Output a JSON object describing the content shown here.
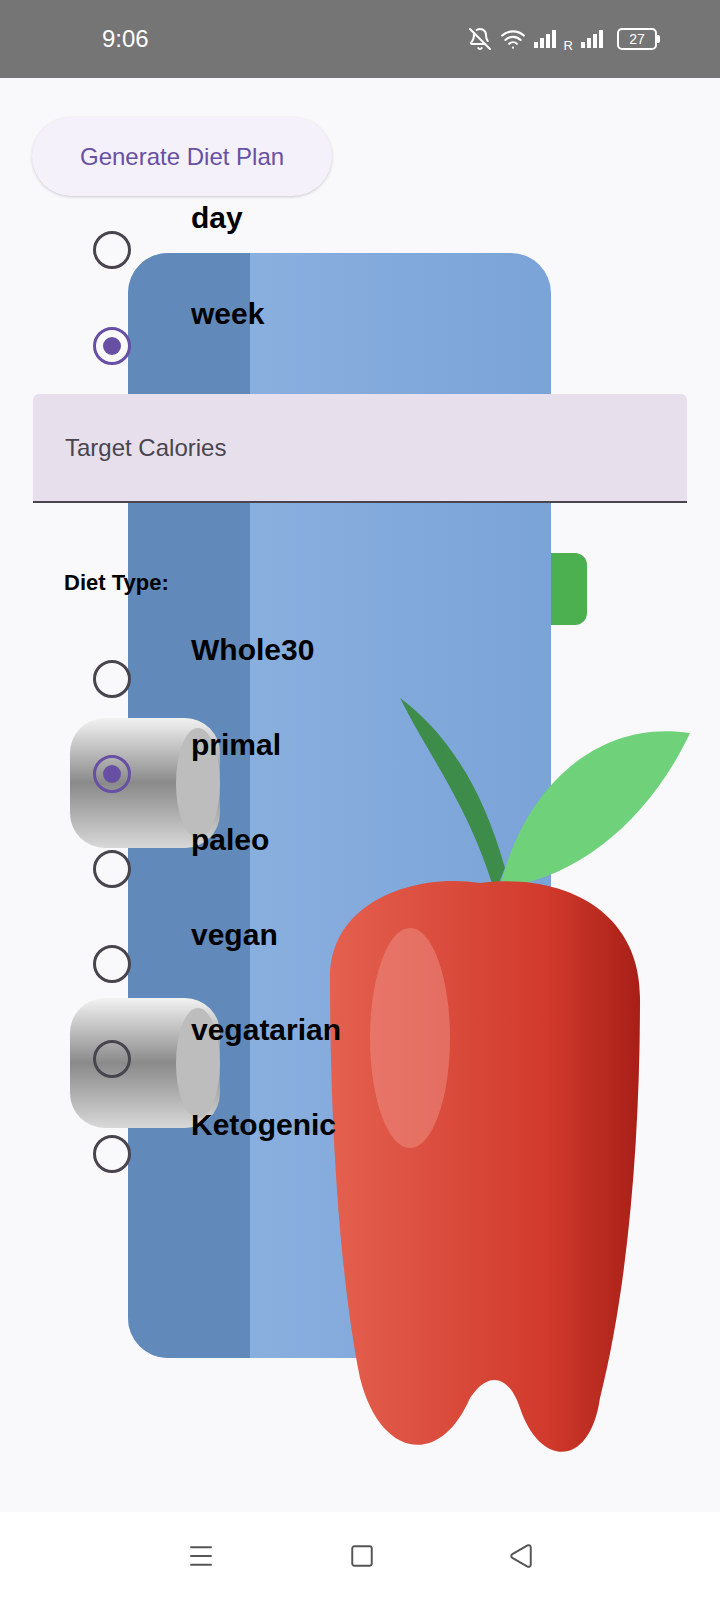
{
  "status_bar": {
    "time": "9:06",
    "roaming": "R",
    "battery": "27"
  },
  "generate_button": {
    "label": "Generate Diet Plan"
  },
  "period_options": [
    {
      "label": "day",
      "selected": false
    },
    {
      "label": "week",
      "selected": true
    }
  ],
  "calories_field": {
    "placeholder": "Target Calories",
    "value": ""
  },
  "diet_type": {
    "label": "Diet Type:",
    "options": [
      {
        "label": "Whole30",
        "selected": false
      },
      {
        "label": "primal",
        "selected": true
      },
      {
        "label": "paleo",
        "selected": false
      },
      {
        "label": "vegan",
        "selected": false
      },
      {
        "label": "vegatarian",
        "selected": false
      },
      {
        "label": "Ketogenic",
        "selected": false
      }
    ]
  }
}
